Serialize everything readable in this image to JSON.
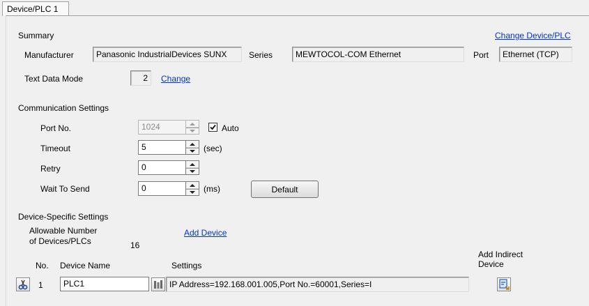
{
  "tabs": [
    {
      "label": "Device/PLC 1"
    }
  ],
  "summary": {
    "heading": "Summary",
    "change_device_link": "Change Device/PLC",
    "manufacturer_label": "Manufacturer",
    "manufacturer_value": "Panasonic IndustrialDevices SUNX",
    "series_label": "Series",
    "series_value": "MEWTOCOL-COM Ethernet",
    "port_label": "Port",
    "port_value": "Ethernet (TCP)",
    "text_data_mode_label": "Text Data Mode",
    "text_data_mode_value": "2",
    "change_link": "Change"
  },
  "comm": {
    "heading": "Communication Settings",
    "port_no_label": "Port No.",
    "port_no_value": "1024",
    "auto_label": "Auto",
    "auto_checked": true,
    "timeout_label": "Timeout",
    "timeout_value": "5",
    "timeout_unit": "(sec)",
    "retry_label": "Retry",
    "retry_value": "0",
    "wait_label": "Wait To Send",
    "wait_value": "0",
    "wait_unit": "(ms)",
    "default_button": "Default"
  },
  "device": {
    "heading": "Device-Specific Settings",
    "allowable_line1": "Allowable Number",
    "allowable_line2": "of Devices/PLCs",
    "allowable_count": "16",
    "add_device_link": "Add Device",
    "col_no": "No.",
    "col_device_name": "Device Name",
    "col_settings": "Settings",
    "add_indirect_line1": "Add Indirect",
    "add_indirect_line2": "Device",
    "rows": [
      {
        "no": "1",
        "name": "PLC1",
        "settings": "IP Address=192.168.001.005,Port No.=60001,Series=I"
      }
    ]
  },
  "colors": {
    "link": "#0033cc",
    "background": "#f0f0f0"
  }
}
